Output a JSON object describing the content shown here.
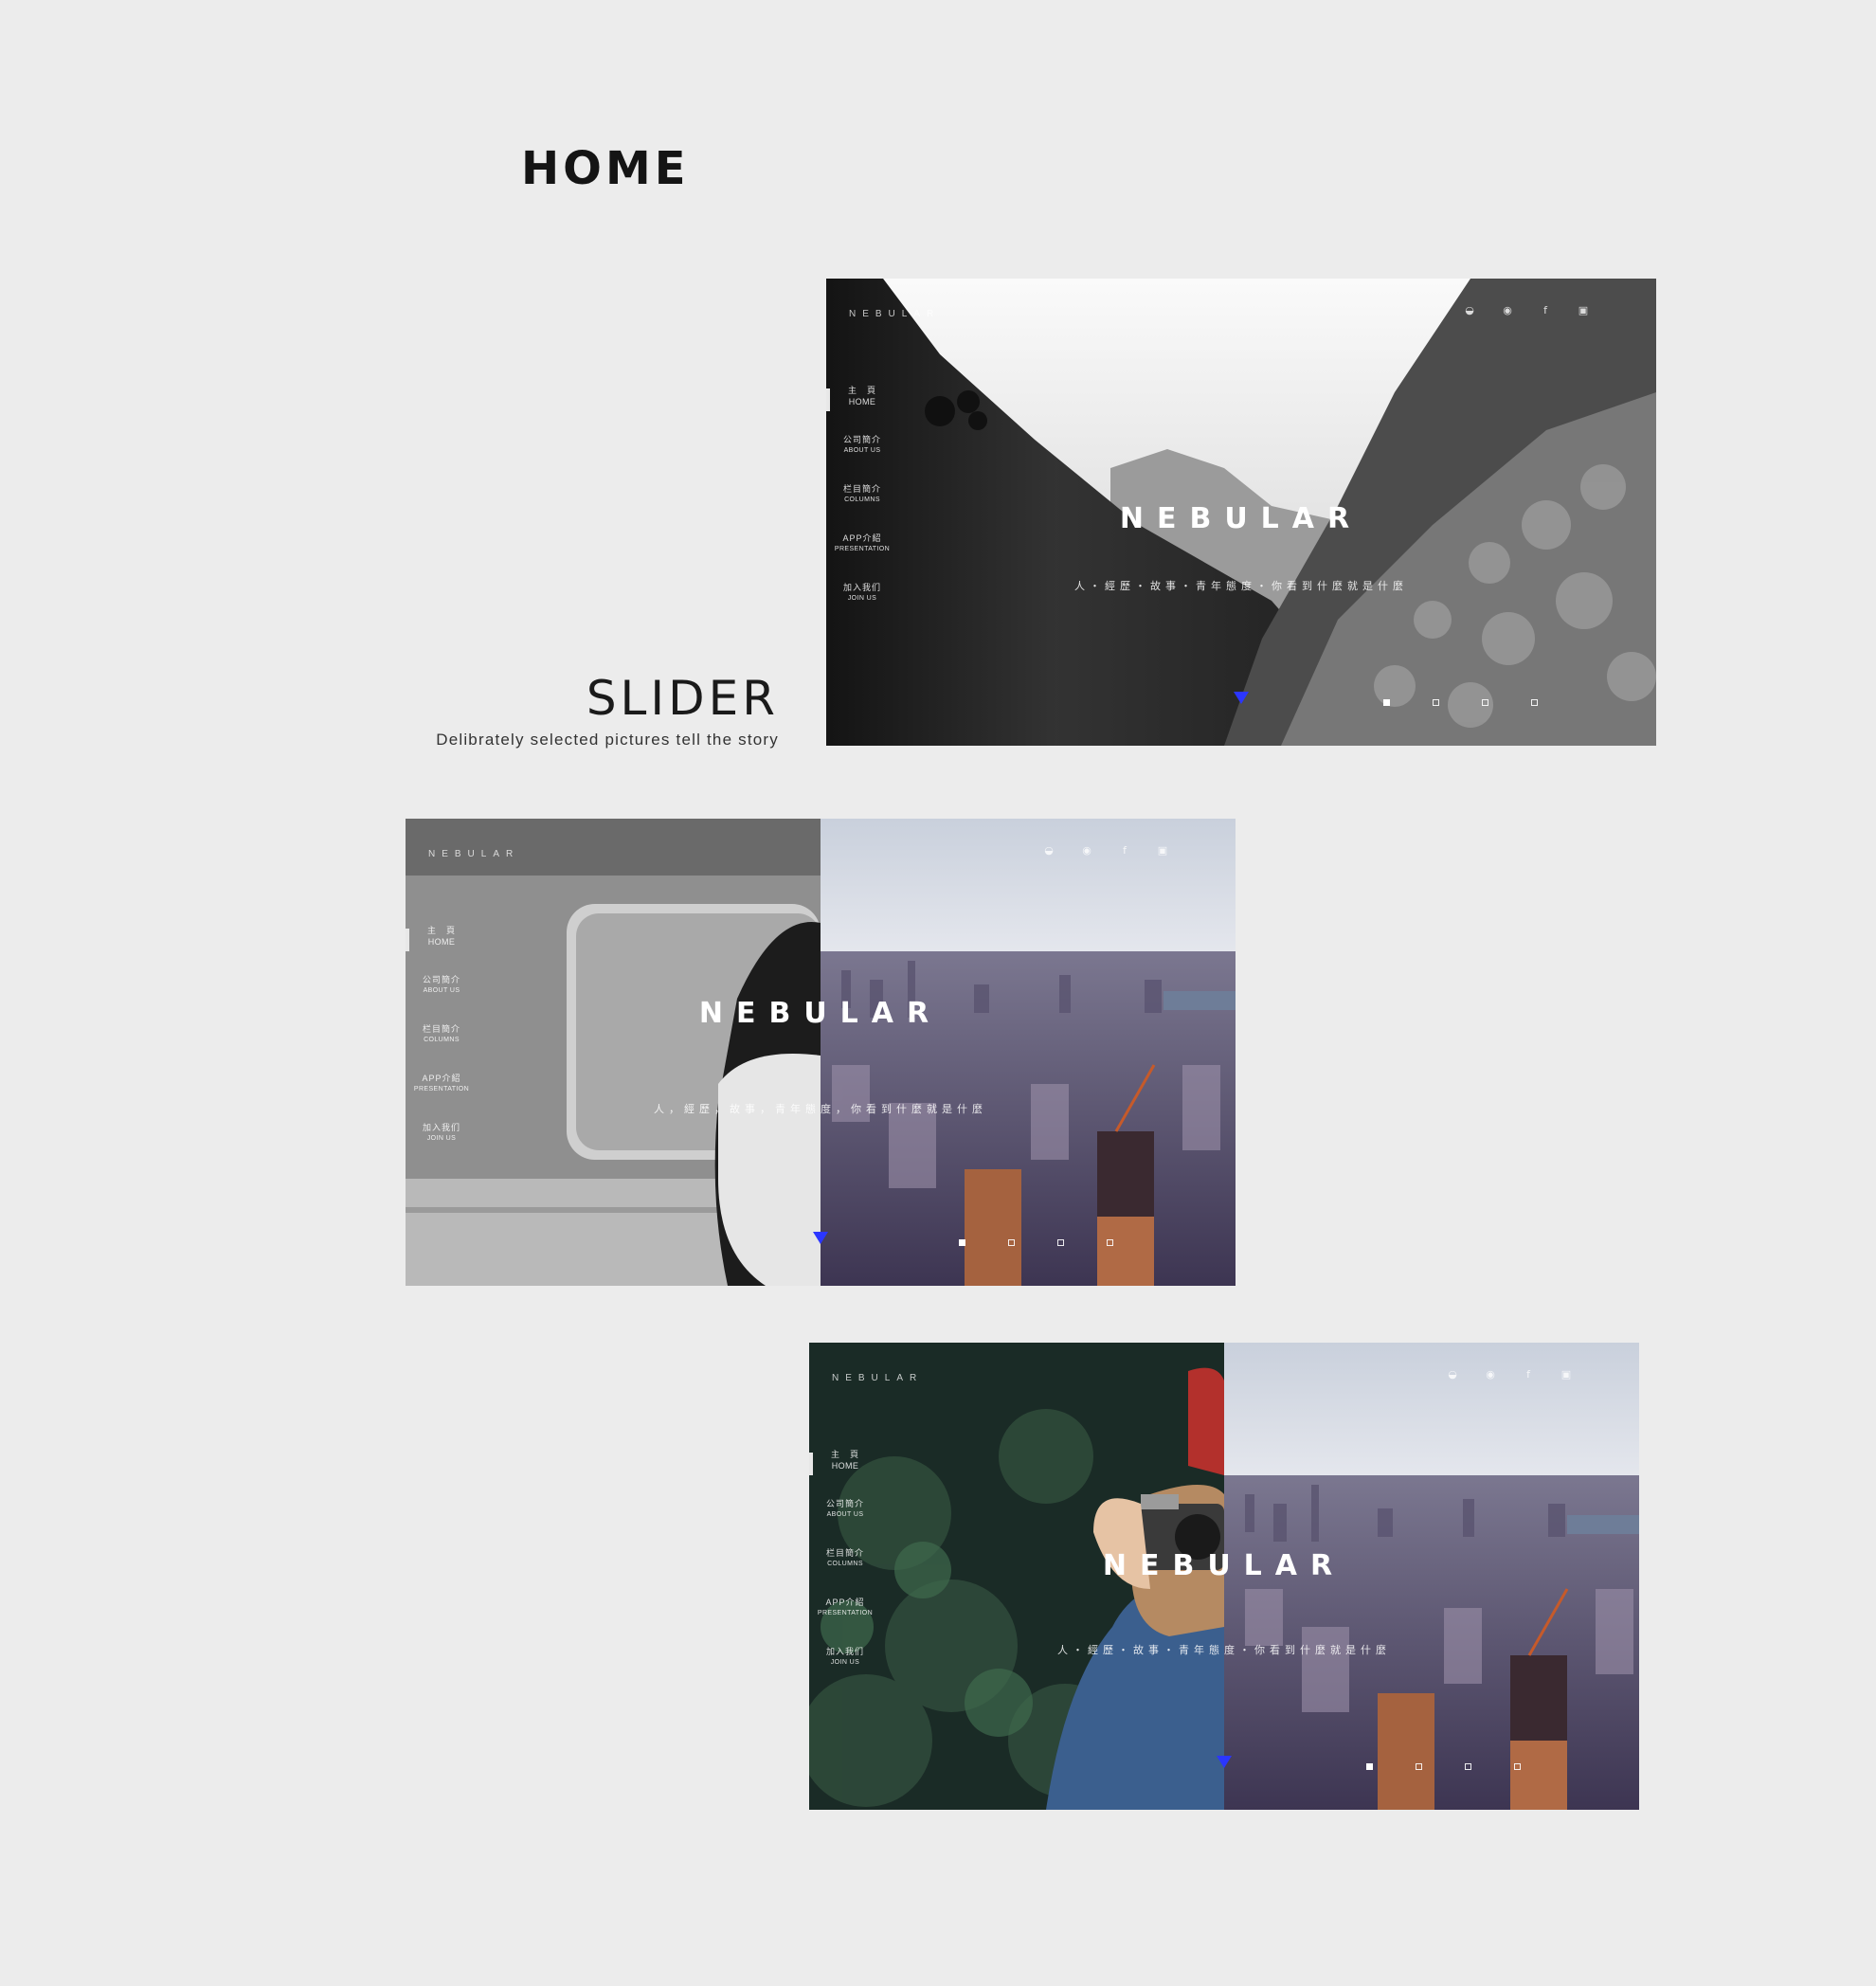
{
  "section_title": "HOME",
  "slider": {
    "title": "SLIDER",
    "caption": "Delibrately selected pictures tell the story"
  },
  "site": {
    "logo": "NEBULAR",
    "brand": "NEBULAR",
    "tagline_dot": "人・經歷・故事・青年態度・你看到什麼就是什麼",
    "tagline_comma": "人，經歷，故事，青年態度，你看到什麼就是什麼",
    "nav": [
      {
        "cn": "主　頁",
        "en": "HOME"
      },
      {
        "cn": "公司簡介",
        "en": "ABOUT US"
      },
      {
        "cn": "栏目簡介",
        "en": "COLUMNS"
      },
      {
        "cn": "APP介紹",
        "en": "PRESENTATION"
      },
      {
        "cn": "加入我们",
        "en": "JOIN US"
      }
    ],
    "social": [
      "wechat-icon",
      "weibo-icon",
      "facebook-icon",
      "instagram-icon"
    ],
    "accent_color": "#2b36ff"
  }
}
